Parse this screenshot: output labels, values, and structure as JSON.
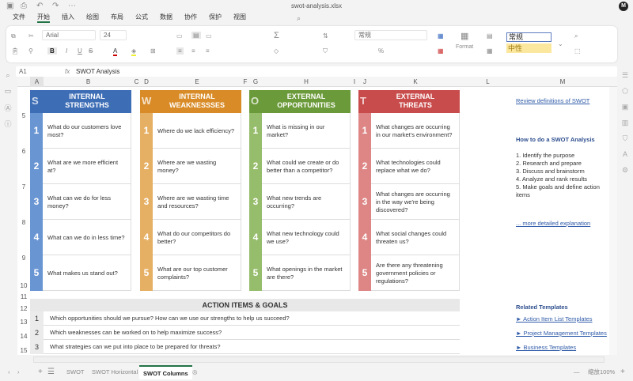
{
  "window": {
    "title": "swot-analysis.xlsx",
    "avatar": "M"
  },
  "menu": [
    "文件",
    "开始",
    "插入",
    "绘图",
    "布局",
    "公式",
    "数据",
    "协作",
    "保护",
    "视图"
  ],
  "ribbon": {
    "font": "Arial",
    "size": "24",
    "number_format": "常规",
    "format_label": "Format",
    "style_normal": "常规",
    "style_neutral": "中性"
  },
  "formula_bar": {
    "cell": "A1",
    "fx": "fx",
    "value": "SWOT Analysis"
  },
  "columns": [
    "A",
    "B",
    "C",
    "D",
    "E",
    "F",
    "G",
    "H",
    "I",
    "J",
    "K",
    "L",
    "M"
  ],
  "rows": [
    "5",
    "6",
    "7",
    "8",
    "9",
    "10",
    "11",
    "12",
    "13",
    "14",
    "15"
  ],
  "quadrants": [
    {
      "letter": "S",
      "title1": "INTERNAL",
      "title2": "STRENGTHS",
      "color": "#3d6db5",
      "side": "#6a95d3",
      "items": [
        "What do our customers love most?",
        "What are we more efficient at?",
        "What can we do for less money?",
        "What can we do in less time?",
        "What makes us stand out?"
      ]
    },
    {
      "letter": "W",
      "title1": "INTERNAL",
      "title2": "WEAKNESSSES",
      "color": "#d88b27",
      "side": "#e6b064",
      "items": [
        "Where do we lack efficiency?",
        "Where are we wasting money?",
        "Where are we wasting time and resources?",
        "What do our competitors do better?",
        "What are our top customer complaints?"
      ]
    },
    {
      "letter": "O",
      "title1": "EXTERNAL",
      "title2": "OPPORTUNITIES",
      "color": "#6b9a3a",
      "side": "#96bd6b",
      "items": [
        "What is missing in our market?",
        "What could we create or do better than a competitor?",
        "What new trends are occurring?",
        "What new technology could we use?",
        "What openings in the market are there?"
      ]
    },
    {
      "letter": "T",
      "title1": "EXTERNAL",
      "title2": "THREATS",
      "color": "#c94c4c",
      "side": "#de8686",
      "items": [
        "What changes are occurring in our market's environment?",
        "What technologies could replace what we do?",
        "What changes are occurring in the way we're being discovered?",
        "What social changes could threaten us?",
        "Are there any threatening government policies or regulations?"
      ]
    }
  ],
  "item_numbers": [
    "1",
    "2",
    "3",
    "4",
    "5"
  ],
  "actions": {
    "title": "ACTION ITEMS & GOALS",
    "rows": [
      {
        "n": "1",
        "text": "Which opportunities should we pursue? How can we use our strengths to help us succeed?"
      },
      {
        "n": "2",
        "text": "Which weaknesses can be worked on to help maximize success?"
      },
      {
        "n": "3",
        "text": "What strategies can we put into place to be prepared for threats?"
      }
    ]
  },
  "side": {
    "review": "Review definitions of SWOT",
    "howto": "How to do a SWOT Analysis",
    "steps": [
      "1. Identify the purpose",
      "2. Research and prepare",
      "3. Discuss and brainstorm",
      "4. Analyze and rank results",
      "5. Make goals and define action items"
    ],
    "more": "... more detailed explanation",
    "related": "Related Templates",
    "links": [
      "► Action Item List Templates",
      "► Project Management Templates",
      "► Business Templates"
    ]
  },
  "tabs": [
    "SWOT",
    "SWOT Horizontal",
    "SWOT Columns"
  ],
  "zoom": "缩放100%"
}
